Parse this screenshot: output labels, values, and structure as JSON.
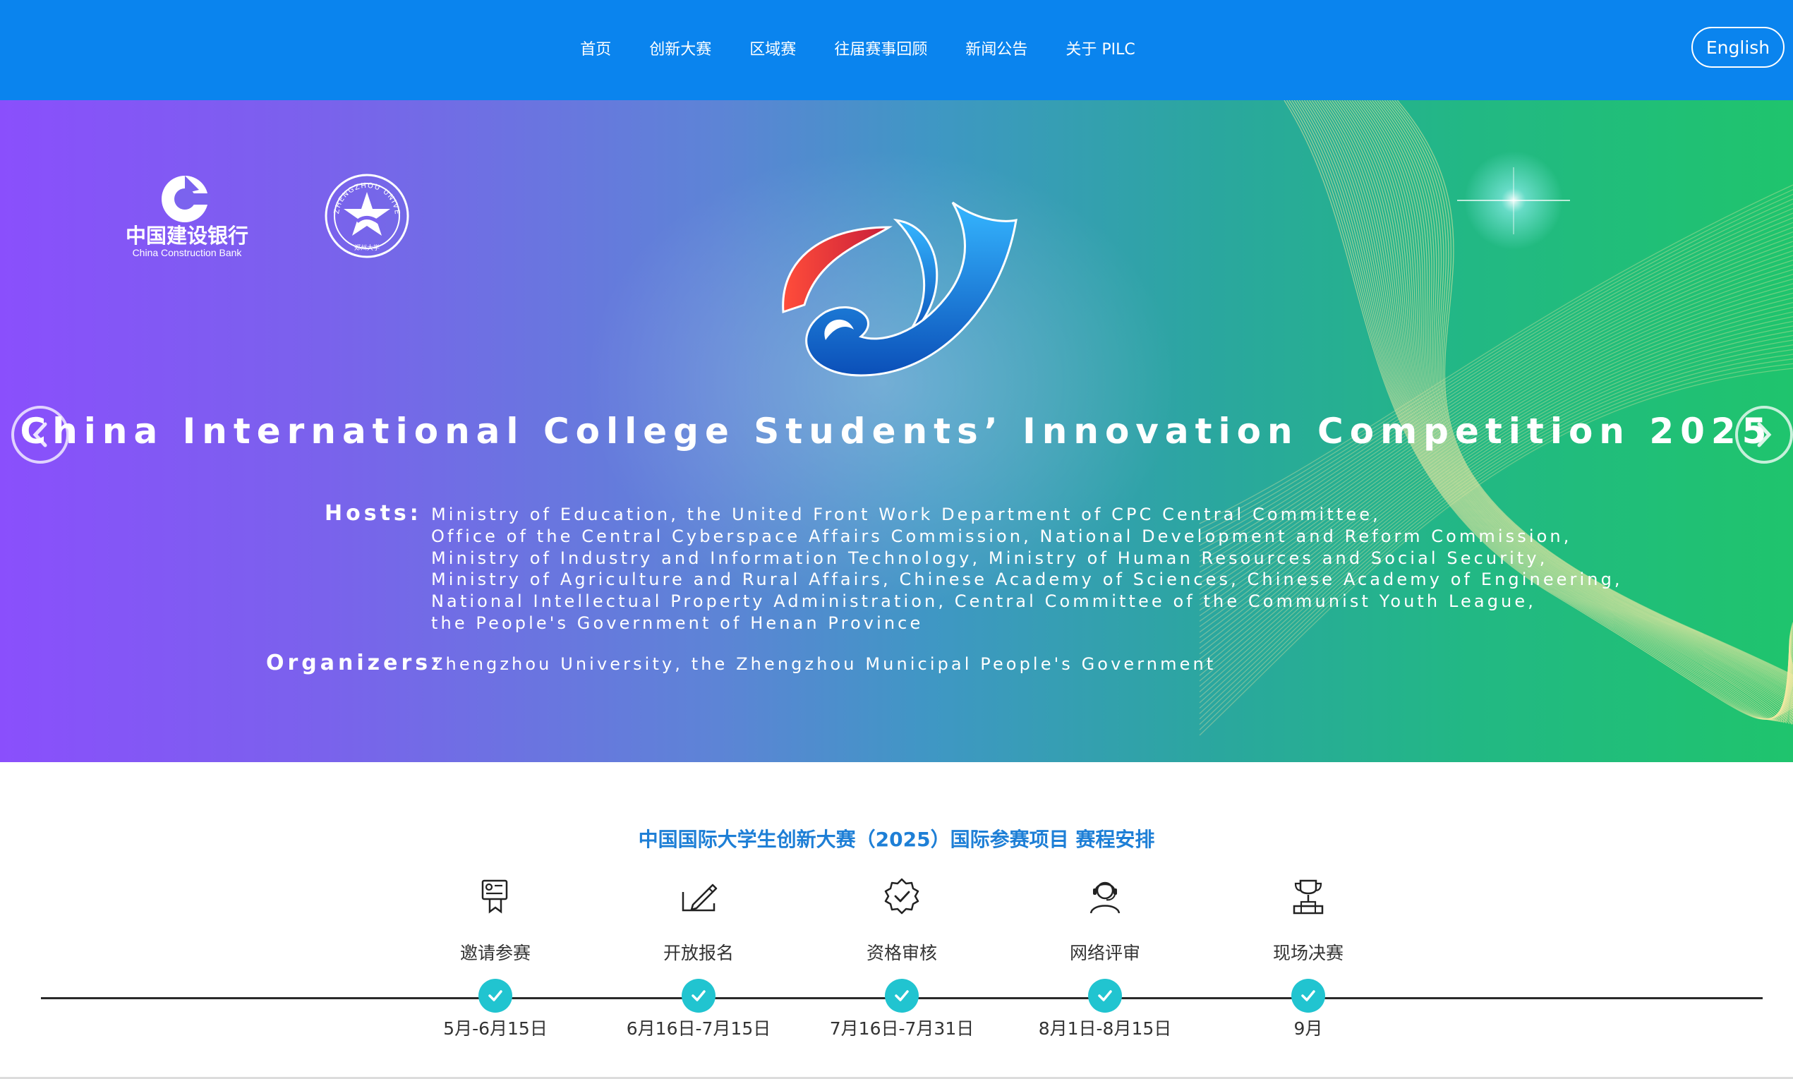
{
  "nav": {
    "items": [
      {
        "label": "首页"
      },
      {
        "label": "创新大赛"
      },
      {
        "label": "区域赛"
      },
      {
        "label": "往届赛事回顾"
      },
      {
        "label": "新闻公告"
      },
      {
        "label": "关于 PILC"
      }
    ],
    "language_button": "English"
  },
  "banner": {
    "sponsor_logo": {
      "name_cn": "中国建设银行",
      "name_en": "China Construction Bank"
    },
    "partner_logo": {
      "name_en": "ZHENGZHOU UNIVERSITY",
      "name_cn": "郑州大学"
    },
    "title": "China International College Students’ Innovation Competition 2025",
    "hosts_label": "Hosts:",
    "hosts_lines": [
      "Ministry of Education, the United Front Work Department of CPC Central Committee,",
      "Office of the Central Cyberspace Affairs Commission, National Development and Reform Commission,",
      "Ministry of Industry and Information Technology, Ministry of Human Resources and Social Security,",
      "Ministry of Agriculture and Rural Affairs, Chinese Academy of Sciences, Chinese Academy of Engineering,",
      "National Intellectual Property Administration, Central Committee of the Communist Youth League,",
      "the People's Government of Henan Province"
    ],
    "organizers_label": "Organizers:",
    "organizers_text": "Zhengzhou University, the Zhengzhou Municipal People's Government"
  },
  "schedule": {
    "title": "中国国际大学生创新大赛（2025）国际参赛项目 赛程安排",
    "stages": [
      {
        "label": "邀请参赛",
        "date": "5月-6月15日",
        "icon": "invitation-icon"
      },
      {
        "label": "开放报名",
        "date": "6月16日-7月15日",
        "icon": "signup-pen-icon"
      },
      {
        "label": "资格审核",
        "date": "7月16日-7月31日",
        "icon": "verified-badge-icon"
      },
      {
        "label": "网络评审",
        "date": "8月1日-8月15日",
        "icon": "online-reviewer-icon"
      },
      {
        "label": "现场决赛",
        "date": "9月",
        "icon": "trophy-icon"
      }
    ]
  },
  "colors": {
    "header_bg": "#0a84ee",
    "schedule_title": "#1e7fd6",
    "check_bg": "#21c4d0"
  }
}
